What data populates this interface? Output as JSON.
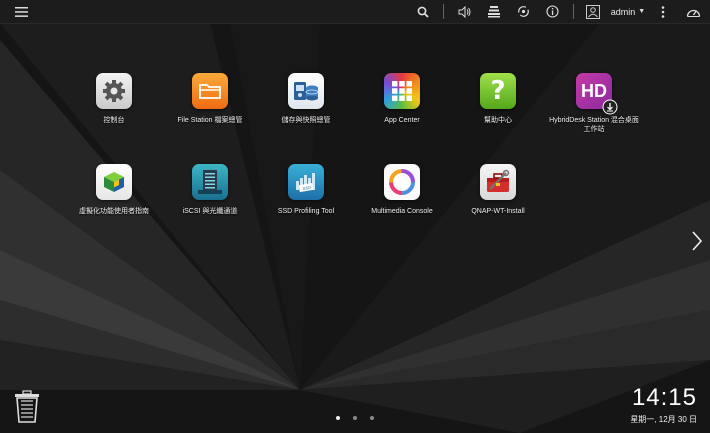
{
  "topbar": {
    "user_label": "admin",
    "icons": [
      "menu-icon",
      "search-icon",
      "volume-icon",
      "tasks-icon",
      "sync-icon",
      "info-icon",
      "user-icon",
      "options-icon",
      "dashboard-icon"
    ]
  },
  "apps": [
    {
      "label": "控制台",
      "icon": "control-panel-icon"
    },
    {
      "label": "File Station 檔案總管",
      "icon": "folder-icon"
    },
    {
      "label": "儲存與快照總管",
      "icon": "storage-icon"
    },
    {
      "label": "App Center",
      "icon": "app-grid-icon"
    },
    {
      "label": "幫助中心",
      "icon": "help-icon"
    },
    {
      "label": "HybridDesk Station 混合桌面工作站",
      "icon": "hybriddesk-icon"
    },
    {
      "label": "虛擬化功能使用者指南",
      "icon": "virtualization-icon"
    },
    {
      "label": "iSCSI 與光纖通道",
      "icon": "iscsi-icon"
    },
    {
      "label": "SSD Profiling Tool",
      "icon": "ssd-icon"
    },
    {
      "label": "Multimedia Console",
      "icon": "multimedia-icon"
    },
    {
      "label": "QNAP-WT-Install",
      "icon": "toolbox-icon"
    }
  ],
  "clock": {
    "time": "14:15",
    "date": "星期一, 12月 30 日"
  },
  "pager": {
    "pages": 3,
    "current": 1
  }
}
